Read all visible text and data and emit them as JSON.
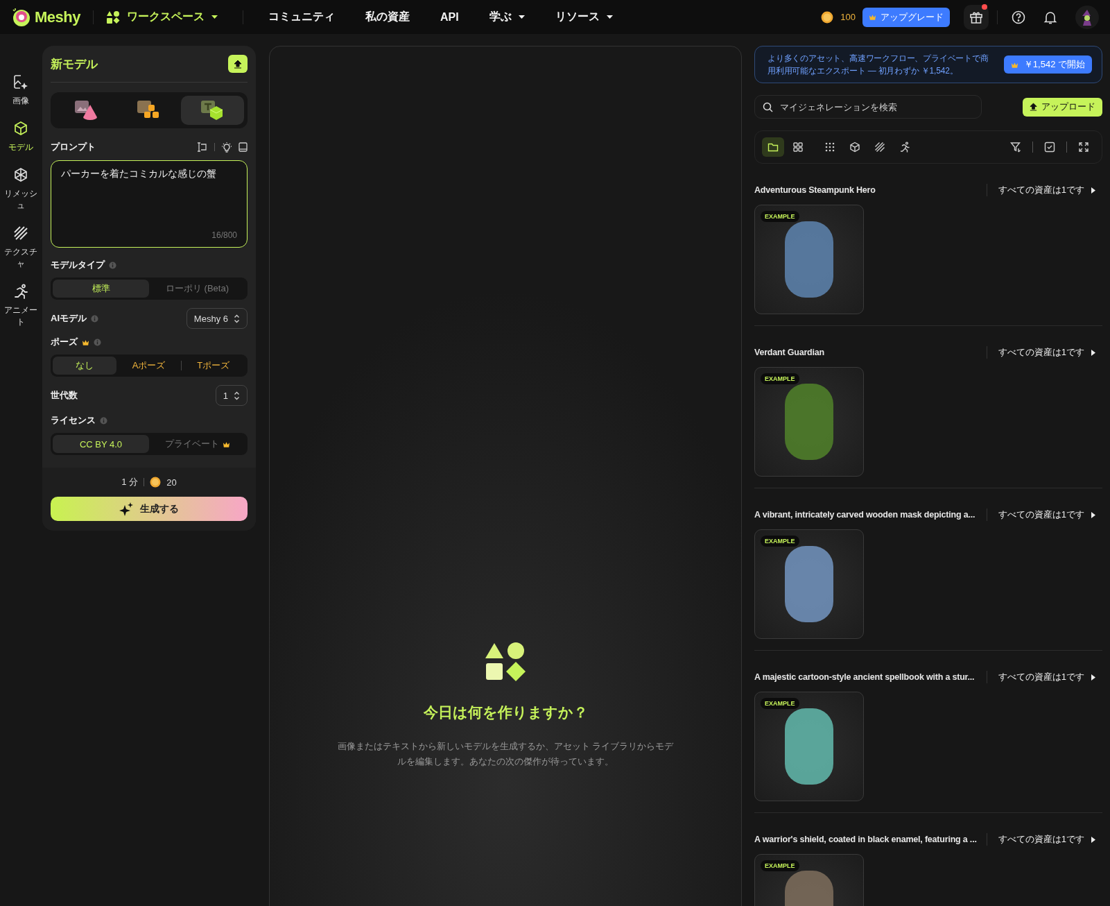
{
  "nav": {
    "logo": "Meshy",
    "items": [
      {
        "label": "ワークスペース",
        "selected": true,
        "dropdown": true
      },
      {
        "label": "コミュニティ",
        "selected": false,
        "dropdown": false
      },
      {
        "label": "私の資産",
        "selected": false,
        "dropdown": false
      },
      {
        "label": "API",
        "selected": false,
        "dropdown": false
      },
      {
        "label": "学ぶ",
        "selected": false,
        "dropdown": true
      },
      {
        "label": "リソース",
        "selected": false,
        "dropdown": true
      }
    ]
  },
  "account": {
    "credits": "100",
    "upgrade": "アップグレード",
    "gift_badge": true
  },
  "rail": [
    {
      "label": "画像",
      "kind": "image",
      "selected": false
    },
    {
      "label": "モデル",
      "kind": "model",
      "selected": true
    },
    {
      "label": "リメッシュ",
      "kind": "remesh",
      "selected": false
    },
    {
      "label": "テクスチャ",
      "kind": "texture",
      "selected": false
    },
    {
      "label": "アニメート",
      "kind": "animate",
      "selected": false
    }
  ],
  "panel": {
    "title": "新モデル",
    "modes": [
      {
        "kind": "image",
        "selected": false
      },
      {
        "kind": "multi",
        "selected": false
      },
      {
        "kind": "text",
        "selected": true
      }
    ],
    "prompt": {
      "label": "プロンプト",
      "value": "パーカーを着たコミカルな感じの蟹",
      "counter": "16/800"
    },
    "model_type": {
      "label": "モデルタイプ",
      "info": true,
      "options": [
        {
          "label": "標準",
          "selected": true,
          "premium": false,
          "crown": false
        },
        {
          "label": "ローポリ (Beta)",
          "selected": false,
          "premium": false,
          "crown": false
        }
      ]
    },
    "ai_model": {
      "label": "AIモデル",
      "info": true,
      "value": "Meshy 6"
    },
    "pose": {
      "label": "ポーズ",
      "info": true,
      "crown": true,
      "options": [
        {
          "label": "なし",
          "selected": true,
          "premium": false,
          "crown": false
        },
        {
          "label": "Aポーズ",
          "selected": false,
          "premium": true,
          "crown": false
        },
        {
          "label": "Tポーズ",
          "selected": false,
          "premium": true,
          "crown": false
        }
      ]
    },
    "generations": {
      "label": "世代数",
      "value": "1"
    },
    "license": {
      "label": "ライセンス",
      "info": true,
      "options": [
        {
          "label": "CC BY 4.0",
          "selected": true,
          "premium": false,
          "crown": false
        },
        {
          "label": "プライベート",
          "selected": false,
          "premium": false,
          "crown": true
        }
      ]
    },
    "time": "1 分",
    "cost": "20",
    "generate": "生成する"
  },
  "empty_state": {
    "heading": "今日は何を作りますか？",
    "description": "画像またはテキストから新しいモデルを生成するか、アセット ライブラリからモデルを編集します。あなたの次の傑作が待っています。"
  },
  "promo": {
    "text": "より多くのアセット、高速ワークフロー、プライベートで商用利用可能なエクスポート — 初月わずか ￥1,542。",
    "button": "￥1,542 で開始"
  },
  "search": {
    "placeholder": "マイジェネレーションを検索"
  },
  "upload": "アップロード",
  "toolbar": [
    {
      "kind": "folder",
      "selected": true
    },
    {
      "kind": "grid",
      "selected": false
    },
    {
      "kind": "dots",
      "selected": false
    },
    {
      "kind": "cube",
      "selected": false
    },
    {
      "kind": "stripes",
      "selected": false
    },
    {
      "kind": "run",
      "selected": false
    },
    {
      "kind": "filter",
      "selected": false
    },
    {
      "kind": "check",
      "selected": false
    },
    {
      "kind": "expand",
      "selected": false
    }
  ],
  "assets": [
    {
      "title": "Adventurous Steampunk Hero",
      "link": "すべての資産は1です",
      "badge": "EXAMPLE",
      "color": "#5b7fa8"
    },
    {
      "title": "Verdant Guardian",
      "link": "すべての資産は1です",
      "badge": "EXAMPLE",
      "color": "#4f7d2a"
    },
    {
      "title": "A vibrant, intricately carved wooden mask depicting a...",
      "link": "すべての資産は1です",
      "badge": "EXAMPLE",
      "color": "#6f8fb8"
    },
    {
      "title": "A majestic cartoon-style ancient spellbook with a stur...",
      "link": "すべての資産は1です",
      "badge": "EXAMPLE",
      "color": "#5fb3a6"
    },
    {
      "title": "A warrior's shield, coated in black enamel, featuring a ...",
      "link": "すべての資産は1です",
      "badge": "EXAMPLE",
      "color": "#7a6a5a"
    }
  ]
}
